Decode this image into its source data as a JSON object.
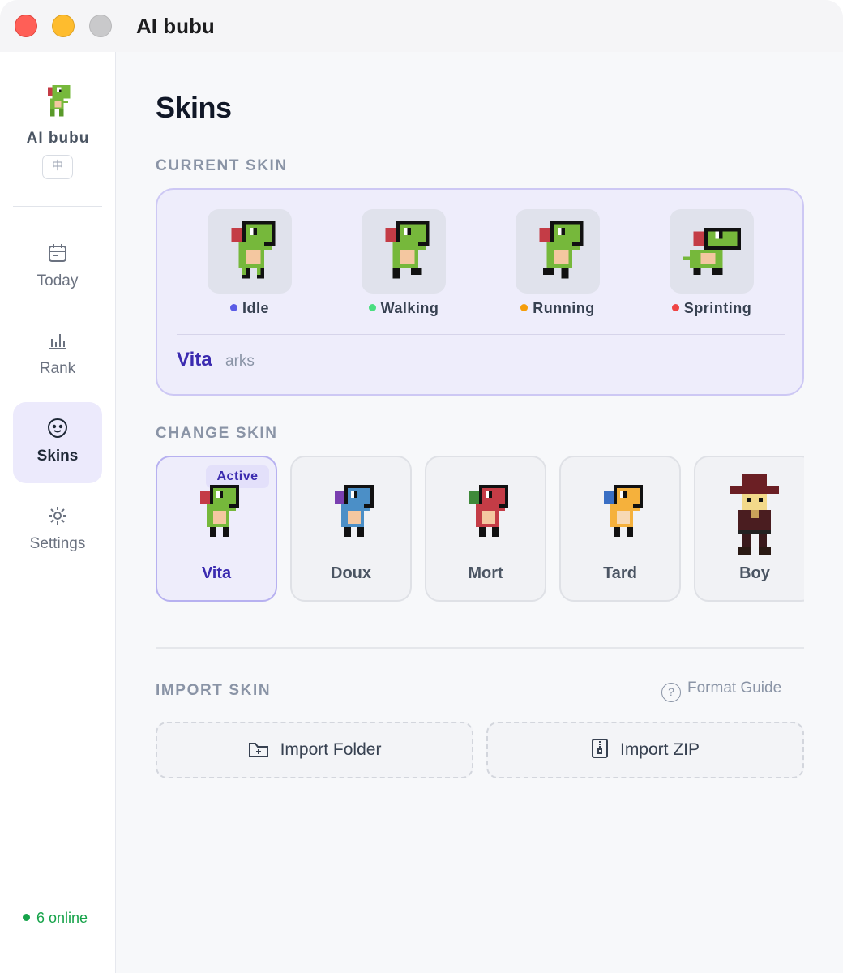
{
  "window": {
    "title": "AI bubu"
  },
  "sidebar": {
    "brand": "AI bubu",
    "lang_button": "中",
    "items": [
      {
        "label": "Today",
        "icon": "calendar-icon"
      },
      {
        "label": "Rank",
        "icon": "bar-chart-icon"
      },
      {
        "label": "Skins",
        "icon": "smiley-icon",
        "active": true
      },
      {
        "label": "Settings",
        "icon": "gear-icon"
      }
    ],
    "online_status": "6 online",
    "online_color": "#16a34a"
  },
  "main": {
    "title": "Skins",
    "current_skin": {
      "section_label": "CURRENT SKIN",
      "animations": [
        {
          "label": "Idle",
          "dot_color": "#5b5ce6"
        },
        {
          "label": "Walking",
          "dot_color": "#4ade80"
        },
        {
          "label": "Running",
          "dot_color": "#f59e0b"
        },
        {
          "label": "Sprinting",
          "dot_color": "#ef4444"
        }
      ],
      "name": "Vita",
      "author": "arks"
    },
    "change_skin": {
      "section_label": "CHANGE SKIN",
      "active_badge": "Active",
      "skins": [
        {
          "name": "Vita",
          "color": "#76b83b",
          "active": true
        },
        {
          "name": "Doux",
          "color": "#4b8fc7"
        },
        {
          "name": "Mort",
          "color": "#c43c46"
        },
        {
          "name": "Tard",
          "color": "#f5b13c"
        },
        {
          "name": "Boy",
          "color": "#6b1f24"
        }
      ]
    },
    "import_skin": {
      "section_label": "IMPORT SKIN",
      "format_guide": "Format Guide",
      "import_folder": "Import Folder",
      "import_zip": "Import ZIP"
    }
  },
  "colors": {
    "accent": "#3b2bb0",
    "accent_bg": "#eeedfb"
  }
}
